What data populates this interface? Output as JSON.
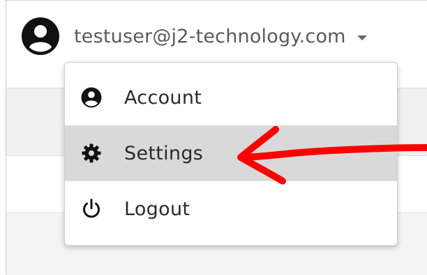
{
  "user": {
    "email": "testuser@j2-technology.com",
    "avatar_icon": "user-circle-icon",
    "chevron_icon": "chevron-down-icon"
  },
  "menu": {
    "items": [
      {
        "label": "Account",
        "icon": "user-circle-icon"
      },
      {
        "label": "Settings",
        "icon": "gear-icon",
        "highlighted": true
      },
      {
        "label": "Logout",
        "icon": "power-icon"
      }
    ]
  },
  "annotation": {
    "type": "red-arrow",
    "color": "#ff0000",
    "points_to": "Settings"
  }
}
